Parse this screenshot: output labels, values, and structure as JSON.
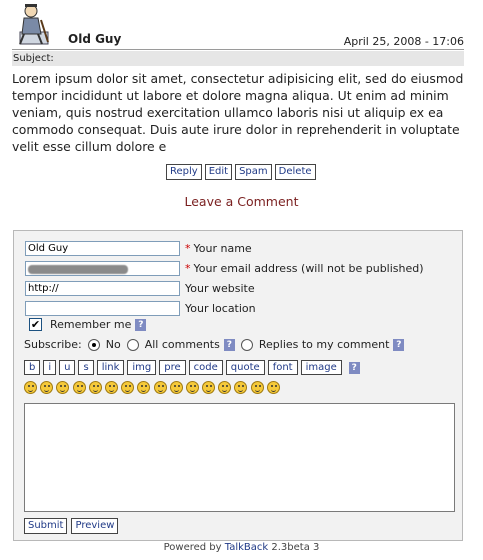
{
  "comment": {
    "author": "Old Guy",
    "date": "April 25, 2008 - 17:06",
    "subject_label": "Subject:",
    "body": "Lorem ipsum dolor sit amet, consectetur adipisicing elit, sed do eiusmod tempor incididunt ut labore et dolore magna aliqua. Ut enim ad minim veniam, quis nostrud exercitation ullamco laboris nisi ut aliquip ex ea commodo consequat. Duis aute irure dolor in reprehenderit in voluptate velit esse cillum dolore e",
    "actions": [
      "Reply",
      "Edit",
      "Spam",
      "Delete"
    ]
  },
  "leave_comment": "Leave a Comment",
  "form": {
    "name_value": "Old Guy",
    "name_label": "Your name",
    "email_label": "Your email address (will not be published)",
    "website_value": "http://",
    "website_label": "Your website",
    "location_value": "",
    "location_label": "Your location",
    "remember_label": "Remember me",
    "help_glyph": "?",
    "required_mark": "*",
    "subscribe_label": "Subscribe:",
    "subscribe_options": [
      "No",
      "All comments",
      "Replies to my comment"
    ],
    "subscribe_selected": "No",
    "toolbar": [
      "b",
      "i",
      "u",
      "s",
      "link",
      "img",
      "pre",
      "code",
      "quote",
      "font",
      "image"
    ],
    "smiley_count": 16,
    "message_value": "",
    "submit_label": "Submit",
    "preview_label": "Preview"
  },
  "footer": {
    "powered_prefix": "Powered by",
    "brand": "TalkBack",
    "version": "2.3beta 3"
  },
  "colors": {
    "link": "#203a87",
    "leave_comment": "#7a1f1f",
    "required": "#cc0000",
    "help_badge": "#7f8bc2"
  }
}
